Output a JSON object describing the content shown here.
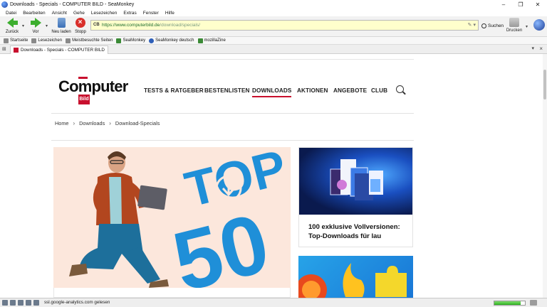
{
  "window": {
    "title": "Downloads - Specials - COMPUTER BILD - SeaMonkey",
    "controls": [
      "–",
      "❐",
      "✕"
    ]
  },
  "menu": [
    "Datei",
    "Bearbeiten",
    "Ansicht",
    "Gehe",
    "Lesezeichen",
    "Extras",
    "Fenster",
    "Hilfe"
  ],
  "toolbar": {
    "back_label": "Zurück",
    "forward_label": "Vor",
    "reload_label": "Neu laden",
    "stop_label": "Stopp",
    "search_label": "Suchen",
    "print_label": "Drucken"
  },
  "urlbar": {
    "url_host": "https://www.computerbild.de",
    "url_path": "/download/specials/"
  },
  "bookmarks": [
    "Startseite",
    "Lesezeichen",
    "Meistbesuchte Seiten",
    "SeaMonkey",
    "SeaMonkey deutsch",
    "mozillaZine"
  ],
  "tab": {
    "title": "Downloads - Specials - COMPUTER BILD"
  },
  "site": {
    "logo_word": "Computer",
    "logo_bild": "Bild",
    "nav": [
      "TESTS & RATGEBER",
      "BESTENLISTEN",
      "DOWNLOADS",
      "AKTIONEN",
      "ANGEBOTE",
      "CLUB"
    ],
    "active_nav": "DOWNLOADS",
    "breadcrumb": [
      "Home",
      "Downloads",
      "Download-Specials"
    ],
    "hero_text_top": "TOP",
    "hero_text_num": "50",
    "card_title": "100 exklusive Vollversionen: Top-Downloads für lau"
  },
  "status": {
    "text": "ssl.google-analytics.com gelesen",
    "progress": 0.85
  },
  "colors": {
    "brand_red": "#c8102e",
    "hero_blue": "#1f8fd8",
    "hero_bg": "#fce7dc",
    "url_bg": "#ffffcc"
  }
}
